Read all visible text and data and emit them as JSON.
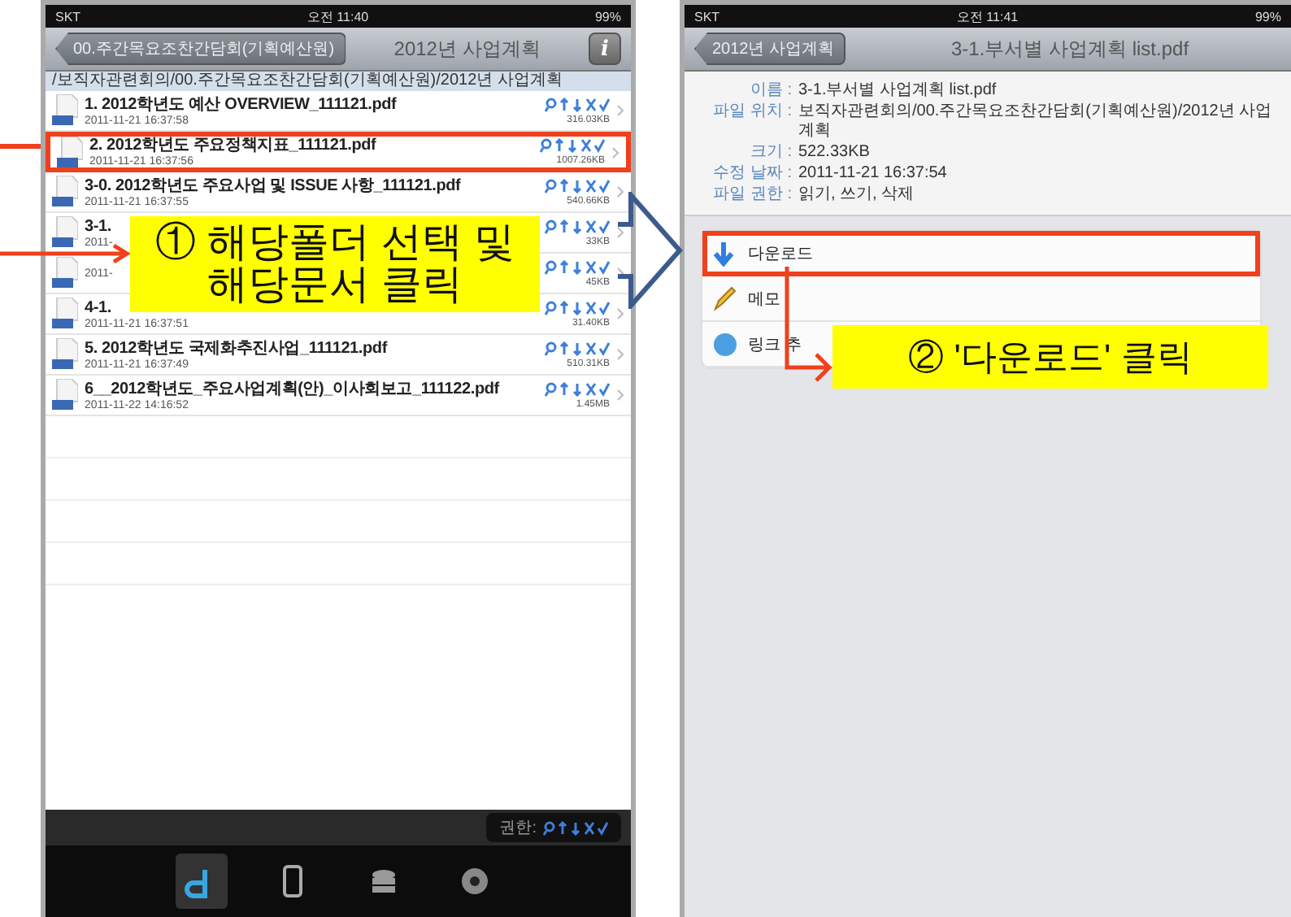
{
  "left_screen": {
    "status_bar": {
      "carrier": "SKT",
      "time": "오전 11:40",
      "battery": "99%"
    },
    "nav": {
      "back": "00.주간목요조찬간담회(기획예산원)",
      "title": "2012년 사업계획",
      "info": "i"
    },
    "path": "/보직자관련회의/00.주간목요조찬간담회(기획예산원)/2012년 사업계획",
    "files": [
      {
        "name": "1. 2012학년도 예산 OVERVIEW_111121.pdf",
        "date": "2011-11-21 16:37:58",
        "size": "316.03KB",
        "selected": false
      },
      {
        "name": "2. 2012학년도 주요정책지표_111121.pdf",
        "date": "2011-11-21 16:37:56",
        "size": "1007.26KB",
        "selected": true
      },
      {
        "name": "3-0. 2012학년도 주요사업 및 ISSUE 사항_111121.pdf",
        "date": "2011-11-21 16:37:55",
        "size": "540.66KB",
        "selected": false
      },
      {
        "name": "3-1.",
        "date": "2011-",
        "size": "33KB",
        "selected": false
      },
      {
        "date": "2011-",
        "size": "45KB",
        "selected": false
      },
      {
        "name": "4-1.",
        "date": "2011-11-21 16:37:51",
        "size": "31.40KB",
        "selected": false
      },
      {
        "name": "5. 2012학년도 국제화추진사업_111121.pdf",
        "date": "2011-11-21 16:37:49",
        "size": "510.31KB",
        "selected": false
      },
      {
        "name": "6__2012학년도_주요사업계획(안)_이사회보고_111122.pdf",
        "date": "2011-11-22 14:16:52",
        "size": "1.45MB",
        "selected": false
      }
    ],
    "toolbar": {
      "label": "권한:"
    },
    "tabs": [
      {
        "kind": "app",
        "selected": true
      },
      {
        "kind": "device",
        "selected": false
      },
      {
        "kind": "library",
        "selected": false
      },
      {
        "kind": "settings",
        "selected": false
      }
    ]
  },
  "right_screen": {
    "status_bar": {
      "carrier": "SKT",
      "time": "오전 11:41",
      "battery": "99%"
    },
    "nav": {
      "back": "2012년 사업계획",
      "title": "3-1.부서별 사업계획 list.pdf"
    },
    "details": [
      {
        "label": "이름 :",
        "value": "3-1.부서별 사업계획 list.pdf"
      },
      {
        "label": "파일 위치 :",
        "value": "보직자관련회의/00.주간목요조찬간담회(기획예산원)/2012년 사업계획"
      },
      {
        "label": "크기 :",
        "value": "522.33KB"
      },
      {
        "label": "수정 날짜 :",
        "value": "2011-11-21 16:37:54"
      },
      {
        "label": "파일 권한 :",
        "value": "읽기, 쓰기, 삭제"
      }
    ],
    "actions": [
      {
        "kind": "download",
        "label": "다운로드",
        "selected": true
      },
      {
        "kind": "memo",
        "label": "메모",
        "selected": false
      },
      {
        "kind": "link",
        "label": "링크 추",
        "selected": false
      }
    ]
  },
  "annotations": [
    {
      "text": "① 해당폴더 선택 및\n해당문서 클릭"
    },
    {
      "text": "② '다운로드' 클릭"
    }
  ]
}
